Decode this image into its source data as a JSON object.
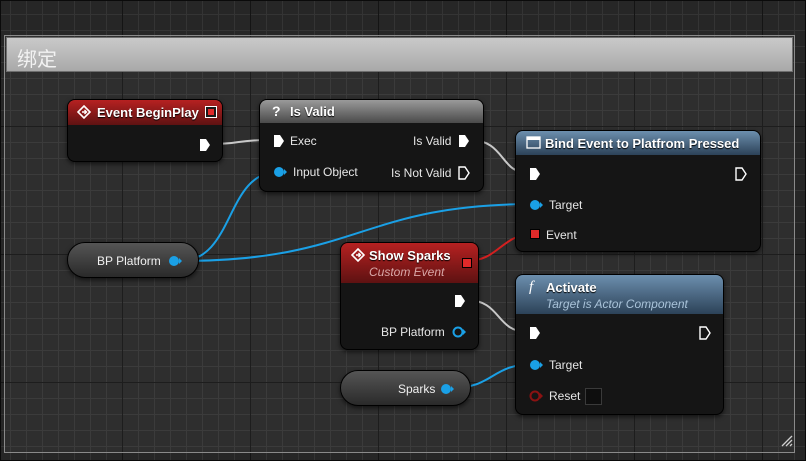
{
  "comment": {
    "title": "绑定"
  },
  "nodes": {
    "begin_play": {
      "title": "Event BeginPlay"
    },
    "is_valid": {
      "title": "Is Valid",
      "exec_label": "Exec",
      "input_object_label": "Input Object",
      "is_valid_label": "Is Valid",
      "is_not_valid_label": "Is Not Valid"
    },
    "bind_event": {
      "title": "Bind Event to Platfrom Pressed",
      "target_label": "Target",
      "event_label": "Event"
    },
    "show_sparks": {
      "title": "Show Sparks",
      "subtitle": "Custom Event",
      "bp_platform_label": "BP Platform"
    },
    "activate": {
      "title": "Activate",
      "subtitle": "Target is Actor Component",
      "target_label": "Target",
      "reset_label": "Reset"
    }
  },
  "variables": {
    "bp_platform": {
      "label": "BP Platform"
    },
    "sparks": {
      "label": "Sparks"
    }
  },
  "colors": {
    "exec_wire": "#c8c8c8",
    "object_wire": "#1aa0e6",
    "delegate_wire": "#d32020",
    "event_header": "#b62121",
    "function_header": "#6c8fae",
    "macro_header": "#9a9a9a",
    "comment_header": "#c0c0c0"
  },
  "icons": {
    "event_icon": "diamond-arrow-icon",
    "macro_icon": "question-mark-icon",
    "function_icon": "function-f-icon",
    "bind_icon": "window-icon"
  }
}
